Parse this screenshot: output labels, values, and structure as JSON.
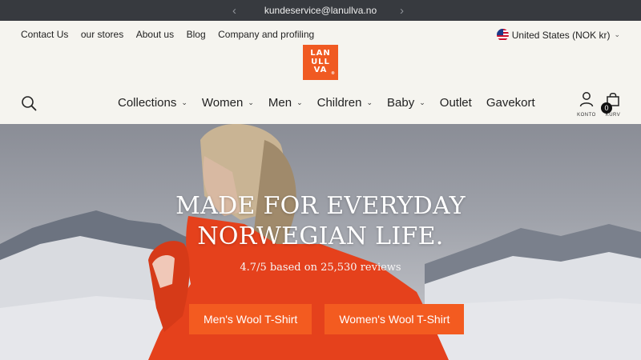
{
  "announcement": {
    "text": "kundeservice@lanullva.no",
    "prev_icon": "chevron-left-icon",
    "next_icon": "chevron-right-icon"
  },
  "utility": {
    "links": [
      "Contact Us",
      "our stores",
      "About us",
      "Blog",
      "Company and profiling"
    ],
    "country": "United States (NOK kr)"
  },
  "logo": {
    "lines": [
      "LAN",
      "ULL",
      "VA"
    ],
    "reg": "®",
    "color": "#f05a22"
  },
  "nav": {
    "items": [
      {
        "label": "Collections",
        "dropdown": true
      },
      {
        "label": "Women",
        "dropdown": true
      },
      {
        "label": "Men",
        "dropdown": true
      },
      {
        "label": "Children",
        "dropdown": true
      },
      {
        "label": "Baby",
        "dropdown": true
      },
      {
        "label": "Outlet",
        "dropdown": false
      },
      {
        "label": "Gavekort",
        "dropdown": false
      }
    ],
    "account_label": "KONTO",
    "cart_label": "KURV",
    "cart_count": "0"
  },
  "hero": {
    "title_line1": "MADE FOR EVERYDAY",
    "title_line2": "NORWEGIAN LIFE.",
    "rating": "4.7/5 based on 25,530 reviews",
    "buttons": [
      "Men's Wool T-Shirt",
      "Women's Wool T-Shirt"
    ],
    "button_color": "#f35b20"
  }
}
